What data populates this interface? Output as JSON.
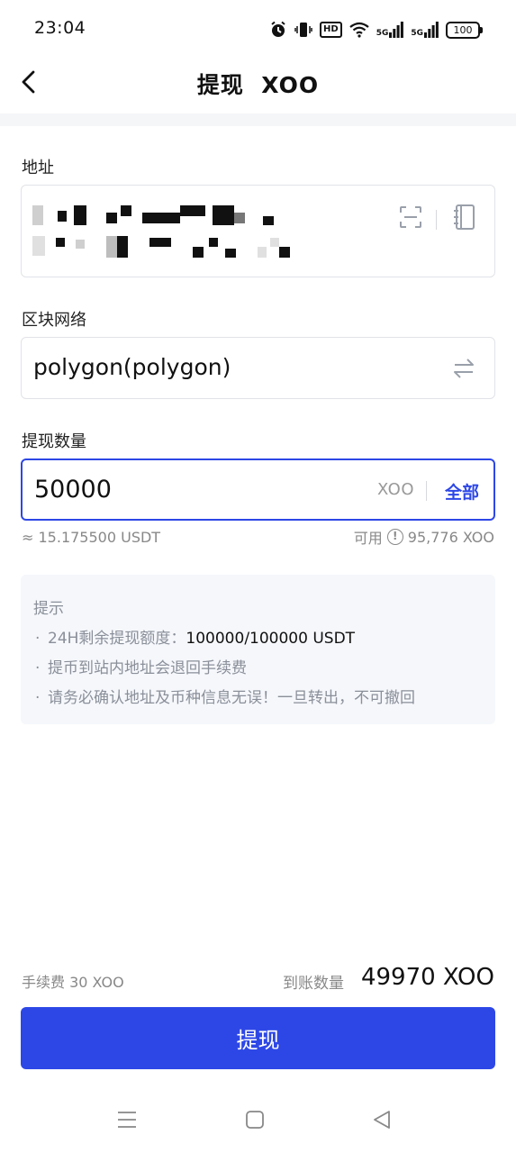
{
  "status_bar": {
    "time": "23:04",
    "hd": "HD",
    "signal1_label": "5G",
    "signal2_label": "5G",
    "battery": "100"
  },
  "header": {
    "title": "提现  XOO"
  },
  "address": {
    "label": "地址",
    "value_obscured": true,
    "icons": [
      "scan-icon",
      "address-book-icon"
    ]
  },
  "network": {
    "label": "区块网络",
    "value": "polygon(polygon)",
    "icon": "swap-icon"
  },
  "amount": {
    "label": "提现数量",
    "value": "50000",
    "unit": "XOO",
    "all_label": "全部",
    "approx": "≈ 15.175500 USDT",
    "available_label": "可用",
    "available_value": "95,776 XOO",
    "accent_color": "#2d47e6"
  },
  "tips": {
    "title": "提示",
    "items": [
      {
        "prefix": "24H剩余提现额度：",
        "value": "100000/100000 USDT"
      },
      {
        "prefix": "提币到站内地址会退回手续费",
        "value": ""
      },
      {
        "prefix": "请务必确认地址及币种信息无误！一旦转出，不可撤回",
        "value": ""
      }
    ]
  },
  "footer": {
    "fee": "手续费 30 XOO",
    "received_label": "到账数量",
    "received_value": "49970 XOO",
    "submit_label": "提现"
  },
  "nav_bar": {
    "icons": [
      "menu-icon",
      "home-icon",
      "back-triangle-icon"
    ]
  }
}
